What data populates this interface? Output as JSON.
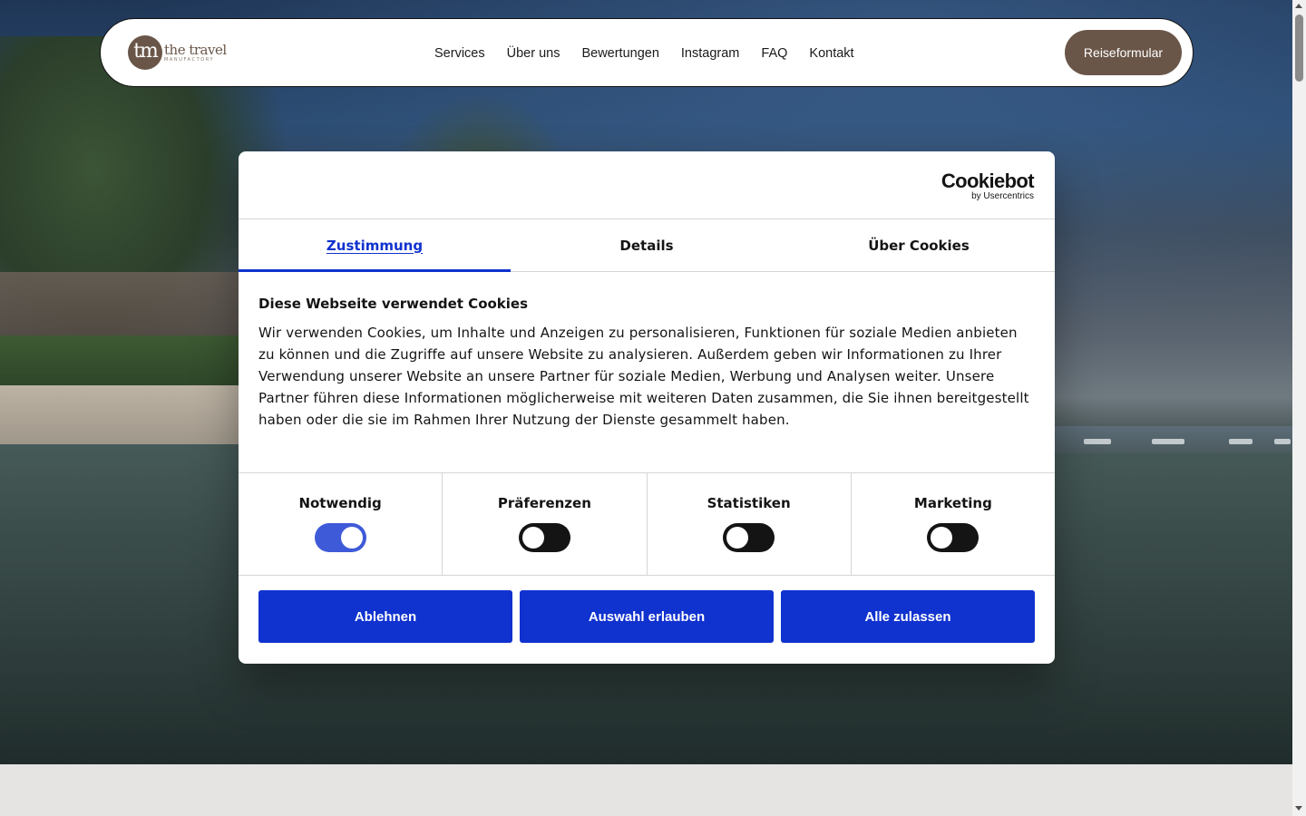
{
  "nav": {
    "logo_mark": "tm",
    "logo_name": "the travel",
    "logo_sub": "MANUFACTORY",
    "links": [
      "Services",
      "Über uns",
      "Bewertungen",
      "Instagram",
      "FAQ",
      "Kontakt"
    ],
    "cta_label": "Reiseformular"
  },
  "cookie_dialog": {
    "brand": "Cookiebot",
    "brand_by": "by Usercentrics",
    "tabs": [
      "Zustimmung",
      "Details",
      "Über Cookies"
    ],
    "active_tab": "Zustimmung",
    "title": "Diese Webseite verwendet Cookies",
    "text": "Wir verwenden Cookies, um Inhalte und Anzeigen zu personalisieren, Funktionen für soziale Medien anbieten zu können und die Zugriffe auf unsere Website zu analysieren. Außerdem geben wir Informationen zu Ihrer Verwendung unserer Website an unsere Partner für soziale Medien, Werbung und Analysen weiter. Unsere Partner führen diese Informationen möglicherweise mit weiteren Daten zusammen, die Sie ihnen bereitgestellt haben oder die sie im Rahmen Ihrer Nutzung der Dienste gesammelt haben.",
    "categories": [
      {
        "label": "Notwendig",
        "enabled": true
      },
      {
        "label": "Präferenzen",
        "enabled": false
      },
      {
        "label": "Statistiken",
        "enabled": false
      },
      {
        "label": "Marketing",
        "enabled": false
      }
    ],
    "buttons": [
      "Ablehnen",
      "Auswahl erlauben",
      "Alle zulassen"
    ],
    "accent_color": "#1032cf"
  },
  "colors": {
    "brand_brown": "#6a5648",
    "toggle_off": "#141414"
  }
}
